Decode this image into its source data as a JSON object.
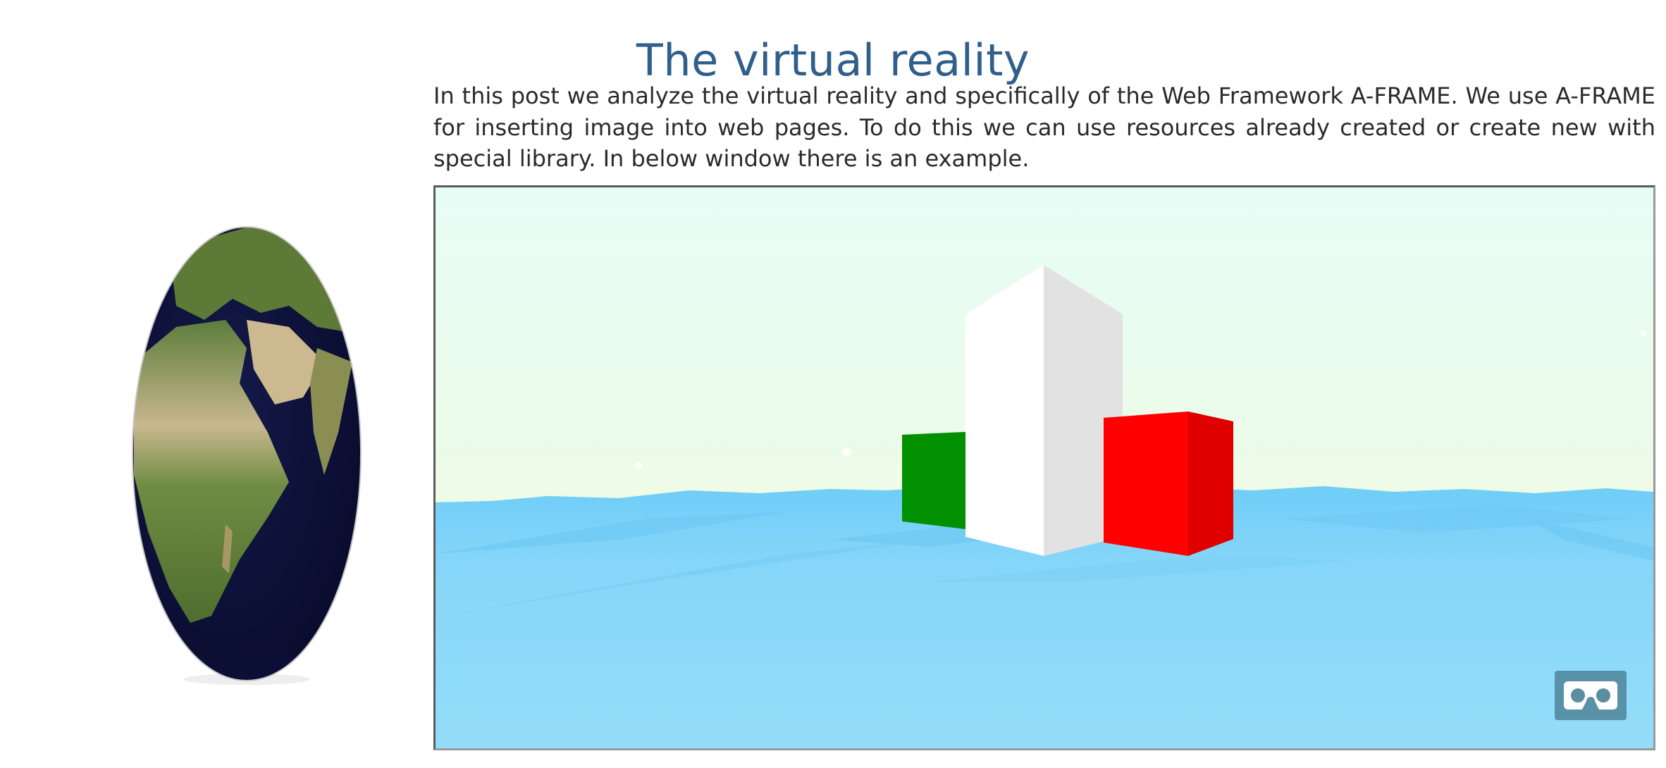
{
  "header": {
    "title": "The virtual reality"
  },
  "article": {
    "intro": "In this post we analyze the virtual reality and specifically of the Web Framework A-FRAME. We use A-FRAME for inserting image into web pages. To do this we can use resources already created or create new with special library. In below window there is an example."
  },
  "scene": {
    "sky_color": "#e8fdf5",
    "water_color": "#8fdcf9",
    "boxes": [
      {
        "name": "green-box",
        "color": "#009000"
      },
      {
        "name": "white-box",
        "color": "#ffffff"
      },
      {
        "name": "red-box",
        "color": "#ff0000"
      }
    ],
    "vr_icon": "vr-headset-icon"
  },
  "globe": {
    "icon": "earth-globe-icon"
  }
}
